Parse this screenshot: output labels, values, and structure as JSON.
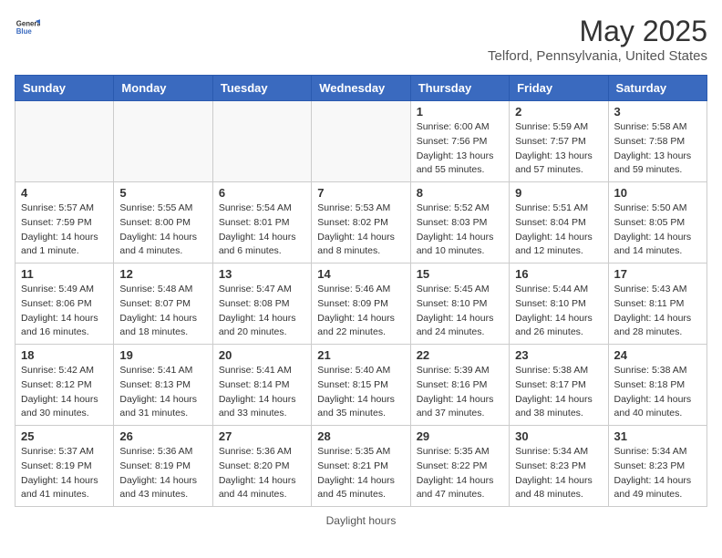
{
  "header": {
    "logo_general": "General",
    "logo_blue": "Blue",
    "main_title": "May 2025",
    "subtitle": "Telford, Pennsylvania, United States"
  },
  "footer": {
    "note": "Daylight hours"
  },
  "days_of_week": [
    "Sunday",
    "Monday",
    "Tuesday",
    "Wednesday",
    "Thursday",
    "Friday",
    "Saturday"
  ],
  "weeks": [
    [
      {
        "day": "",
        "info": ""
      },
      {
        "day": "",
        "info": ""
      },
      {
        "day": "",
        "info": ""
      },
      {
        "day": "",
        "info": ""
      },
      {
        "day": "1",
        "info": "Sunrise: 6:00 AM\nSunset: 7:56 PM\nDaylight: 13 hours\nand 55 minutes."
      },
      {
        "day": "2",
        "info": "Sunrise: 5:59 AM\nSunset: 7:57 PM\nDaylight: 13 hours\nand 57 minutes."
      },
      {
        "day": "3",
        "info": "Sunrise: 5:58 AM\nSunset: 7:58 PM\nDaylight: 13 hours\nand 59 minutes."
      }
    ],
    [
      {
        "day": "4",
        "info": "Sunrise: 5:57 AM\nSunset: 7:59 PM\nDaylight: 14 hours\nand 1 minute."
      },
      {
        "day": "5",
        "info": "Sunrise: 5:55 AM\nSunset: 8:00 PM\nDaylight: 14 hours\nand 4 minutes."
      },
      {
        "day": "6",
        "info": "Sunrise: 5:54 AM\nSunset: 8:01 PM\nDaylight: 14 hours\nand 6 minutes."
      },
      {
        "day": "7",
        "info": "Sunrise: 5:53 AM\nSunset: 8:02 PM\nDaylight: 14 hours\nand 8 minutes."
      },
      {
        "day": "8",
        "info": "Sunrise: 5:52 AM\nSunset: 8:03 PM\nDaylight: 14 hours\nand 10 minutes."
      },
      {
        "day": "9",
        "info": "Sunrise: 5:51 AM\nSunset: 8:04 PM\nDaylight: 14 hours\nand 12 minutes."
      },
      {
        "day": "10",
        "info": "Sunrise: 5:50 AM\nSunset: 8:05 PM\nDaylight: 14 hours\nand 14 minutes."
      }
    ],
    [
      {
        "day": "11",
        "info": "Sunrise: 5:49 AM\nSunset: 8:06 PM\nDaylight: 14 hours\nand 16 minutes."
      },
      {
        "day": "12",
        "info": "Sunrise: 5:48 AM\nSunset: 8:07 PM\nDaylight: 14 hours\nand 18 minutes."
      },
      {
        "day": "13",
        "info": "Sunrise: 5:47 AM\nSunset: 8:08 PM\nDaylight: 14 hours\nand 20 minutes."
      },
      {
        "day": "14",
        "info": "Sunrise: 5:46 AM\nSunset: 8:09 PM\nDaylight: 14 hours\nand 22 minutes."
      },
      {
        "day": "15",
        "info": "Sunrise: 5:45 AM\nSunset: 8:10 PM\nDaylight: 14 hours\nand 24 minutes."
      },
      {
        "day": "16",
        "info": "Sunrise: 5:44 AM\nSunset: 8:10 PM\nDaylight: 14 hours\nand 26 minutes."
      },
      {
        "day": "17",
        "info": "Sunrise: 5:43 AM\nSunset: 8:11 PM\nDaylight: 14 hours\nand 28 minutes."
      }
    ],
    [
      {
        "day": "18",
        "info": "Sunrise: 5:42 AM\nSunset: 8:12 PM\nDaylight: 14 hours\nand 30 minutes."
      },
      {
        "day": "19",
        "info": "Sunrise: 5:41 AM\nSunset: 8:13 PM\nDaylight: 14 hours\nand 31 minutes."
      },
      {
        "day": "20",
        "info": "Sunrise: 5:41 AM\nSunset: 8:14 PM\nDaylight: 14 hours\nand 33 minutes."
      },
      {
        "day": "21",
        "info": "Sunrise: 5:40 AM\nSunset: 8:15 PM\nDaylight: 14 hours\nand 35 minutes."
      },
      {
        "day": "22",
        "info": "Sunrise: 5:39 AM\nSunset: 8:16 PM\nDaylight: 14 hours\nand 37 minutes."
      },
      {
        "day": "23",
        "info": "Sunrise: 5:38 AM\nSunset: 8:17 PM\nDaylight: 14 hours\nand 38 minutes."
      },
      {
        "day": "24",
        "info": "Sunrise: 5:38 AM\nSunset: 8:18 PM\nDaylight: 14 hours\nand 40 minutes."
      }
    ],
    [
      {
        "day": "25",
        "info": "Sunrise: 5:37 AM\nSunset: 8:19 PM\nDaylight: 14 hours\nand 41 minutes."
      },
      {
        "day": "26",
        "info": "Sunrise: 5:36 AM\nSunset: 8:19 PM\nDaylight: 14 hours\nand 43 minutes."
      },
      {
        "day": "27",
        "info": "Sunrise: 5:36 AM\nSunset: 8:20 PM\nDaylight: 14 hours\nand 44 minutes."
      },
      {
        "day": "28",
        "info": "Sunrise: 5:35 AM\nSunset: 8:21 PM\nDaylight: 14 hours\nand 45 minutes."
      },
      {
        "day": "29",
        "info": "Sunrise: 5:35 AM\nSunset: 8:22 PM\nDaylight: 14 hours\nand 47 minutes."
      },
      {
        "day": "30",
        "info": "Sunrise: 5:34 AM\nSunset: 8:23 PM\nDaylight: 14 hours\nand 48 minutes."
      },
      {
        "day": "31",
        "info": "Sunrise: 5:34 AM\nSunset: 8:23 PM\nDaylight: 14 hours\nand 49 minutes."
      }
    ]
  ]
}
